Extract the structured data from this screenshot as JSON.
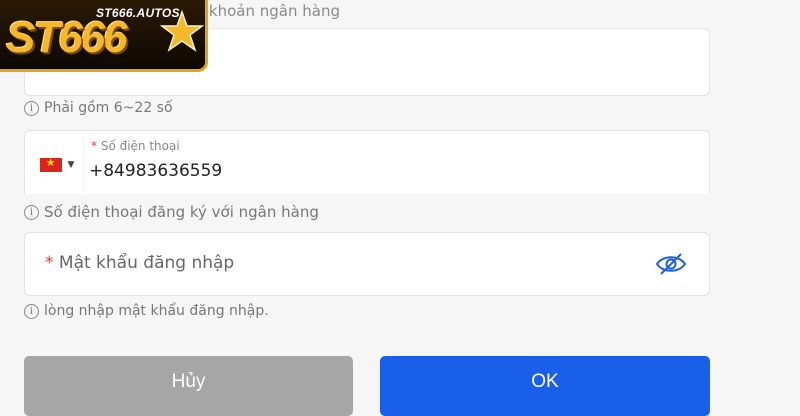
{
  "logo": {
    "domain": "ST666.AUTOS",
    "mark": "ST666"
  },
  "form": {
    "account_label_partial": "i khoản ngân hàng",
    "account_hint": "Phải gồm 6~22 số",
    "phone": {
      "required_mark": "*",
      "label": "Số điện thoại",
      "value": "+84983636559",
      "country_flag_icon": "vietnam-flag-icon"
    },
    "phone_hint": "Số điện thoại đăng ký với ngân hàng",
    "password": {
      "required_mark": "*",
      "placeholder": "Mật khẩu đăng nhập",
      "toggle_icon": "eye-slash-icon"
    },
    "password_hint": "lòng nhập mật khẩu đăng nhập."
  },
  "buttons": {
    "cancel": "Hủy",
    "ok": "OK"
  },
  "colors": {
    "primary": "#1a5fe8",
    "cancel": "#a6a6a6",
    "required": "#e53935",
    "logo_gold": "#f5b82a"
  }
}
